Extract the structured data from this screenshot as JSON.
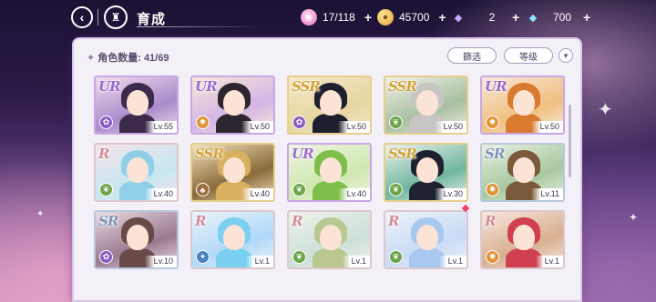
{
  "header": {
    "title": "育成",
    "resources": [
      {
        "name": "candy",
        "value": "17/118",
        "icon": "candy-icon"
      },
      {
        "name": "coin",
        "value": "45700",
        "icon": "coin-icon"
      },
      {
        "name": "gem-purple",
        "value": "2",
        "icon": "diamond-icon"
      },
      {
        "name": "gem-blue",
        "value": "700",
        "icon": "diamond-icon"
      }
    ]
  },
  "panel": {
    "count_label": "角色数量: 41/69",
    "filter_label": "篩选",
    "sort_label": "等级"
  },
  "cards": [
    {
      "rarity": "UR",
      "level": "Lv.55",
      "attr": "purple"
    },
    {
      "rarity": "UR",
      "level": "Lv.50",
      "attr": "orange"
    },
    {
      "rarity": "SSR",
      "level": "Lv.50",
      "attr": "purple"
    },
    {
      "rarity": "SSR",
      "level": "Lv.50",
      "attr": "green"
    },
    {
      "rarity": "UR",
      "level": "Lv.50",
      "attr": "orange"
    },
    {
      "rarity": "R",
      "level": "Lv.40",
      "attr": "green"
    },
    {
      "rarity": "SSR",
      "level": "Lv.40",
      "attr": "brown"
    },
    {
      "rarity": "UR",
      "level": "Lv.40",
      "attr": "green"
    },
    {
      "rarity": "SSR",
      "level": "Lv.30",
      "attr": "green"
    },
    {
      "rarity": "SR",
      "level": "Lv.11",
      "attr": "orange"
    },
    {
      "rarity": "SR",
      "level": "Lv.10",
      "attr": "purple"
    },
    {
      "rarity": "R",
      "level": "Lv.1",
      "attr": "blue"
    },
    {
      "rarity": "R",
      "level": "Lv.1",
      "attr": "green"
    },
    {
      "rarity": "R",
      "level": "Lv.1",
      "attr": "green"
    },
    {
      "rarity": "R",
      "level": "Lv.1",
      "attr": "orange"
    }
  ],
  "colors": {
    "ur": "#9b6ad3",
    "ssr": "#d5a43a",
    "sr": "#7f94b8",
    "r": "#d58a96"
  }
}
